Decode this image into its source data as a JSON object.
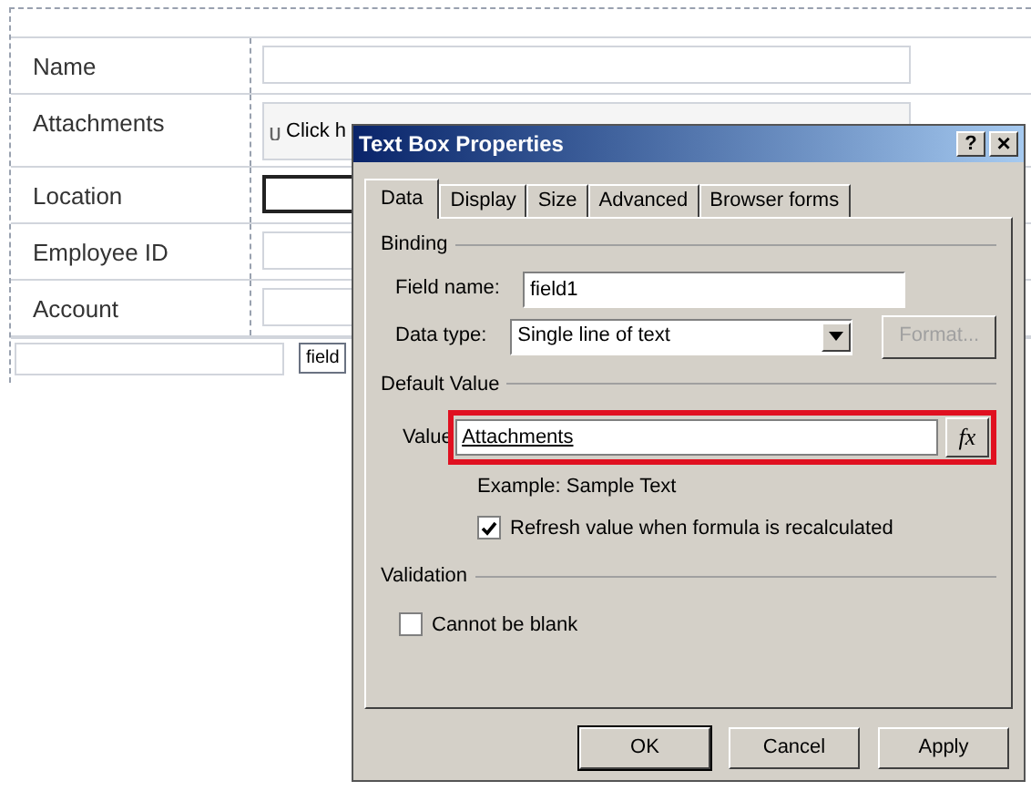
{
  "form": {
    "rows": [
      {
        "label": "Name",
        "kind": "text",
        "focused": false
      },
      {
        "label": "Attachments",
        "kind": "attachment",
        "value": "Click h"
      },
      {
        "label": "Location",
        "kind": "text",
        "focused": true
      },
      {
        "label": "Employee ID",
        "kind": "text",
        "focused": false
      },
      {
        "label": "Account",
        "kind": "text",
        "focused": false
      }
    ],
    "footer_tag": "field"
  },
  "dialog": {
    "title": "Text Box Properties",
    "help": "?",
    "close": "×",
    "tabs": [
      {
        "label": "Data",
        "selected": true
      },
      {
        "label": "Display",
        "selected": false
      },
      {
        "label": "Size",
        "selected": false
      },
      {
        "label": "Advanced",
        "selected": false
      },
      {
        "label": "Browser forms",
        "selected": false
      }
    ],
    "binding": {
      "heading": "Binding",
      "field_name_label": "Field name:",
      "field_name": "field1",
      "data_type_label": "Data type:",
      "data_type": "Single line of text",
      "format_button": "Format...",
      "format_disabled": true
    },
    "default_value": {
      "heading": "Default Value",
      "value_label": "Value",
      "value": "Attachments",
      "fx": "fx",
      "example": "Example: Sample Text",
      "refresh_label": "Refresh value when formula is recalculated",
      "refresh_checked": true
    },
    "validation": {
      "heading": "Validation",
      "cannot_be_blank_label": "Cannot be blank",
      "cannot_be_blank_checked": false
    },
    "buttons": [
      "OK",
      "Cancel",
      "Apply"
    ]
  }
}
